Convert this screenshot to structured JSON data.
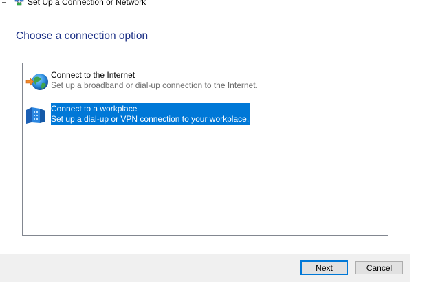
{
  "window": {
    "title": "Set Up a Connection or Network"
  },
  "page": {
    "heading": "Choose a connection option"
  },
  "options": [
    {
      "title": "Connect to the Internet",
      "description": "Set up a broadband or dial-up connection to the Internet.",
      "icon": "globe-internet-icon",
      "selected": false
    },
    {
      "title": "Connect to a workplace",
      "description": "Set up a dial-up or VPN connection to your workplace.",
      "icon": "workplace-connection-icon",
      "selected": true
    }
  ],
  "buttons": {
    "next_label": "Next",
    "cancel_label": "Cancel"
  },
  "colors": {
    "heading": "#1e3287",
    "selection": "#0078d7",
    "default_button_border": "#0078d7",
    "button_bar": "#f0f0f0"
  }
}
